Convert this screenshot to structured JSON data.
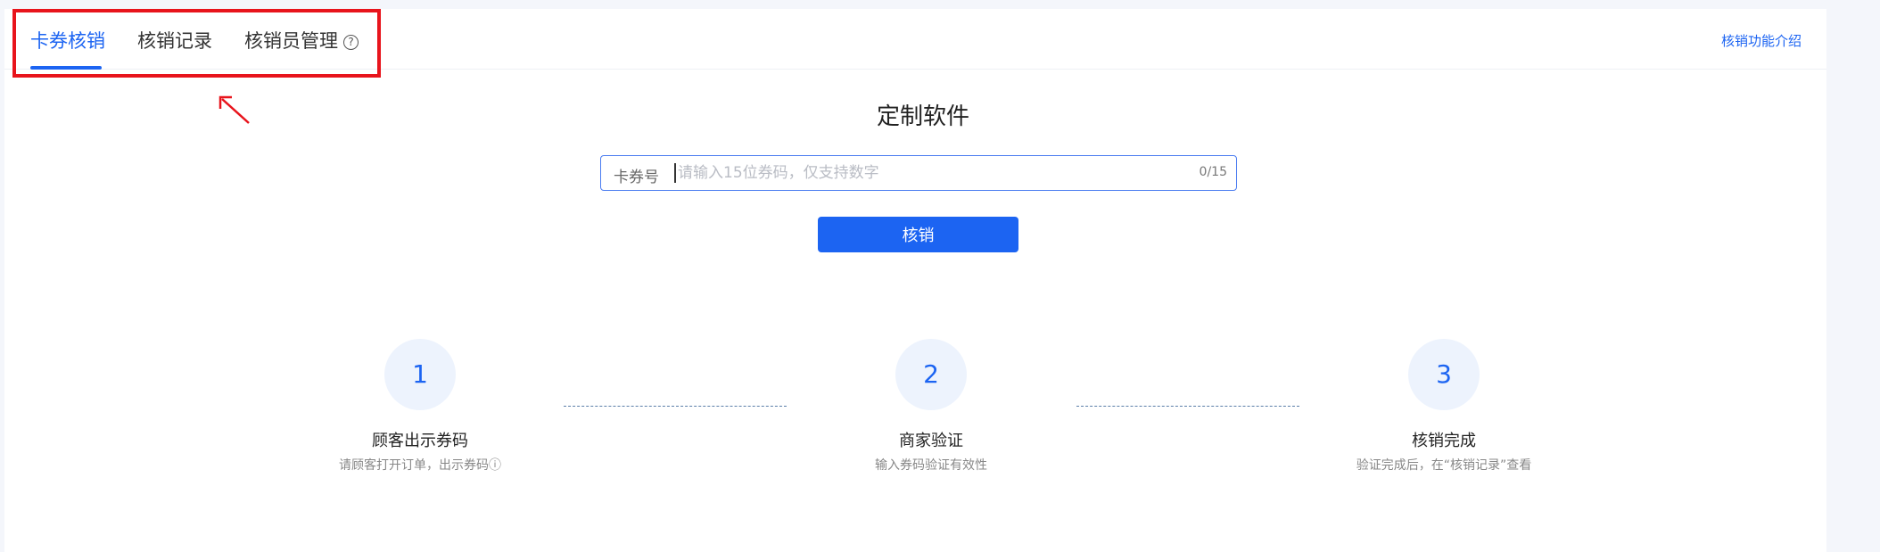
{
  "tabs": [
    {
      "label": "卡券核销",
      "active": true
    },
    {
      "label": "核销记录",
      "active": false
    },
    {
      "label": "核销员管理",
      "active": false
    }
  ],
  "help_icon_glyph": "?",
  "intro_link": "核销功能介绍",
  "page_title": "定制软件",
  "voucher_input": {
    "label": "卡券号",
    "placeholder": "请输入15位券码，仅支持数字",
    "value": "",
    "counter": "0/15"
  },
  "submit_label": "核销",
  "steps": [
    {
      "number": "1",
      "title": "顾客出示券码",
      "desc": "请顾客打开订单，出示券码ⓘ"
    },
    {
      "number": "2",
      "title": "商家验证",
      "desc": "输入券码验证有效性"
    },
    {
      "number": "3",
      "title": "核销完成",
      "desc": "验证完成后，在“核销记录”查看"
    }
  ],
  "colors": {
    "accent": "#1c64f2",
    "highlight": "#e8141c",
    "step_bg": "#edf3fd"
  }
}
